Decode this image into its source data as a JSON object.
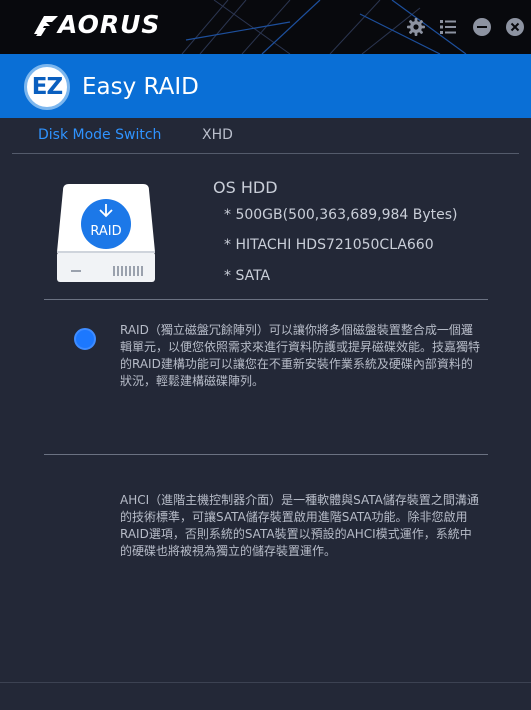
{
  "app": {
    "brand": "AORUS",
    "title": "Easy RAID",
    "badge": "EZ",
    "colors": {
      "accent": "#0a6fd6",
      "active_tab": "#2f93ff",
      "radio": "#1c78ff",
      "background": "#232837"
    }
  },
  "titlebar": {
    "icons": [
      "gear-icon",
      "list-icon",
      "minimize-icon",
      "close-icon"
    ]
  },
  "tabs": [
    {
      "label": "Disk Mode Switch",
      "active": true
    },
    {
      "label": "XHD",
      "active": false
    }
  ],
  "disk": {
    "icon_label": "RAID",
    "title": "OS HDD",
    "capacity": "* 500GB(500,363,689,984 Bytes)",
    "model": "* HITACHI HDS721050CLA660",
    "interface": "* SATA"
  },
  "options": [
    {
      "mode": "RAID",
      "selected": true,
      "description": "RAID（獨立磁盤冗餘陣列）可以讓你將多個磁盤裝置整合成一個邏輯單元，以便您依照需求來進行資料防護或提昇磁碟效能。技嘉獨特的RAID建構功能可以讓您在不重新安裝作業系統及硬碟內部資料的狀況，輕鬆建構磁碟陣列。"
    },
    {
      "mode": "AHCI",
      "selected": false,
      "description": "AHCI（進階主機控制器介面）是一種軟體與SATA儲存裝置之間溝通的技術標準，可讓SATA儲存裝置啟用進階SATA功能。除非您啟用RAID選項，否則系統的SATA裝置以預設的AHCI模式運作，系統中的硬碟也將被視為獨立的儲存裝置運作。"
    }
  ]
}
